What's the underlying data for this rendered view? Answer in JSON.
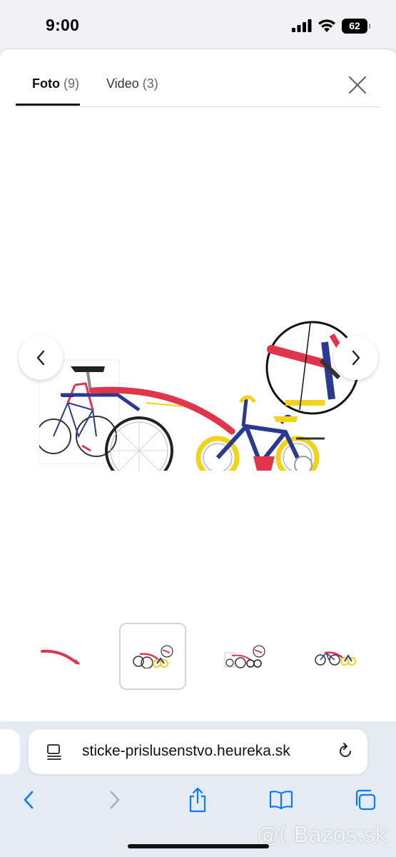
{
  "status_bar": {
    "time": "9:00",
    "battery_level": "62"
  },
  "gallery": {
    "tabs": [
      {
        "label": "Foto",
        "count": "(9)",
        "active": true
      },
      {
        "label": "Video",
        "count": "(3)",
        "active": false
      }
    ],
    "selected_thumbnail": 2,
    "thumbnail_count": 4
  },
  "browser": {
    "url": "sticke-prislusenstvo.heureka.sk"
  },
  "watermark": "@( Bazos.sk",
  "colors": {
    "bike_red": "#e0354a",
    "bike_blue": "#2b3a8e",
    "bike_yellow": "#f3d21a",
    "ios_blue": "#0a7aff"
  },
  "icons": {
    "close": "close-icon",
    "prev": "chevron-left-icon",
    "next": "chevron-right-icon",
    "reload": "reload-icon",
    "share": "share-icon",
    "bookmarks": "book-icon",
    "tabs": "tabs-icon"
  }
}
